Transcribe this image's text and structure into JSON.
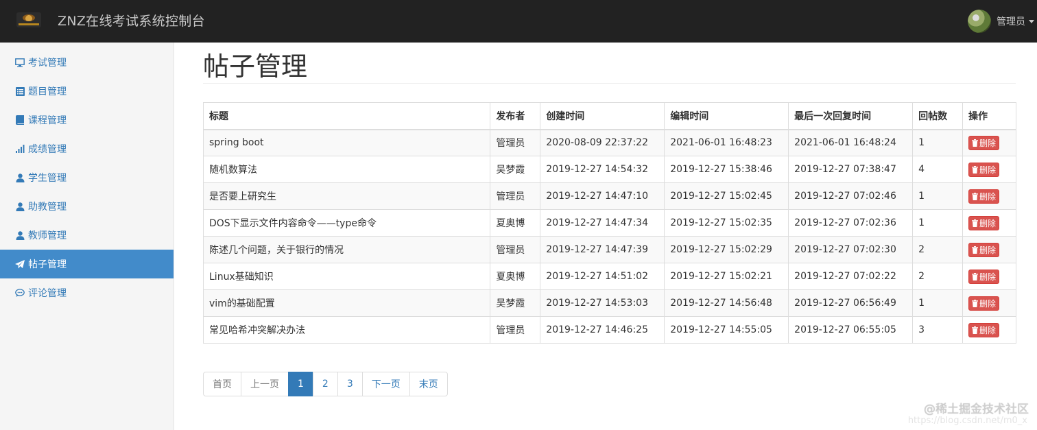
{
  "app": {
    "title": "ZNZ在线考试系统控制台",
    "user_name": "管理员"
  },
  "sidebar": {
    "items": [
      {
        "label": "考试管理",
        "icon": "monitor-icon",
        "active": false
      },
      {
        "label": "题目管理",
        "icon": "list-alt-icon",
        "active": false
      },
      {
        "label": "课程管理",
        "icon": "book-icon",
        "active": false
      },
      {
        "label": "成绩管理",
        "icon": "signal-icon",
        "active": false
      },
      {
        "label": "学生管理",
        "icon": "user-icon",
        "active": false
      },
      {
        "label": "助教管理",
        "icon": "user-icon",
        "active": false
      },
      {
        "label": "教师管理",
        "icon": "user-icon",
        "active": false
      },
      {
        "label": "帖子管理",
        "icon": "send-icon",
        "active": true
      },
      {
        "label": "评论管理",
        "icon": "comment-icon",
        "active": false
      }
    ]
  },
  "main": {
    "page_title": "帖子管理",
    "table": {
      "headers": [
        "标题",
        "发布者",
        "创建时间",
        "编辑时间",
        "最后一次回复时间",
        "回帖数",
        "操作"
      ],
      "rows": [
        {
          "title": "spring boot",
          "author": "管理员",
          "created": "2020-08-09 22:37:22",
          "edited": "2021-06-01 16:48:23",
          "last_reply": "2021-06-01 16:48:24",
          "replies": "1"
        },
        {
          "title": "随机数算法",
          "author": "吴梦霞",
          "created": "2019-12-27 14:54:32",
          "edited": "2019-12-27 15:38:46",
          "last_reply": "2019-12-27 07:38:47",
          "replies": "4"
        },
        {
          "title": "是否要上研究生",
          "author": "管理员",
          "created": "2019-12-27 14:47:10",
          "edited": "2019-12-27 15:02:45",
          "last_reply": "2019-12-27 07:02:46",
          "replies": "1"
        },
        {
          "title": "DOS下显示文件内容命令——type命令",
          "author": "夏奥博",
          "created": "2019-12-27 14:47:34",
          "edited": "2019-12-27 15:02:35",
          "last_reply": "2019-12-27 07:02:36",
          "replies": "1"
        },
        {
          "title": "陈述几个问题，关于银行的情况",
          "author": "管理员",
          "created": "2019-12-27 14:47:39",
          "edited": "2019-12-27 15:02:29",
          "last_reply": "2019-12-27 07:02:30",
          "replies": "2"
        },
        {
          "title": "Linux基础知识",
          "author": "夏奥博",
          "created": "2019-12-27 14:51:02",
          "edited": "2019-12-27 15:02:21",
          "last_reply": "2019-12-27 07:02:22",
          "replies": "2"
        },
        {
          "title": "vim的基础配置",
          "author": "吴梦霞",
          "created": "2019-12-27 14:53:03",
          "edited": "2019-12-27 14:56:48",
          "last_reply": "2019-12-27 06:56:49",
          "replies": "1"
        },
        {
          "title": "常见哈希冲突解决办法",
          "author": "管理员",
          "created": "2019-12-27 14:46:25",
          "edited": "2019-12-27 14:55:05",
          "last_reply": "2019-12-27 06:55:05",
          "replies": "3"
        }
      ],
      "delete_label": "删除"
    },
    "pagination": {
      "first": "首页",
      "prev": "上一页",
      "pages": [
        "1",
        "2",
        "3"
      ],
      "current": "1",
      "next": "下一页",
      "last": "末页"
    }
  },
  "watermark": {
    "text": "@稀土掘金技术社区",
    "url": "https://blog.csdn.net/m0_x"
  },
  "colors": {
    "navbar_bg": "#222222",
    "sidebar_active": "#428bca",
    "link": "#337ab7",
    "danger": "#d9534f"
  }
}
